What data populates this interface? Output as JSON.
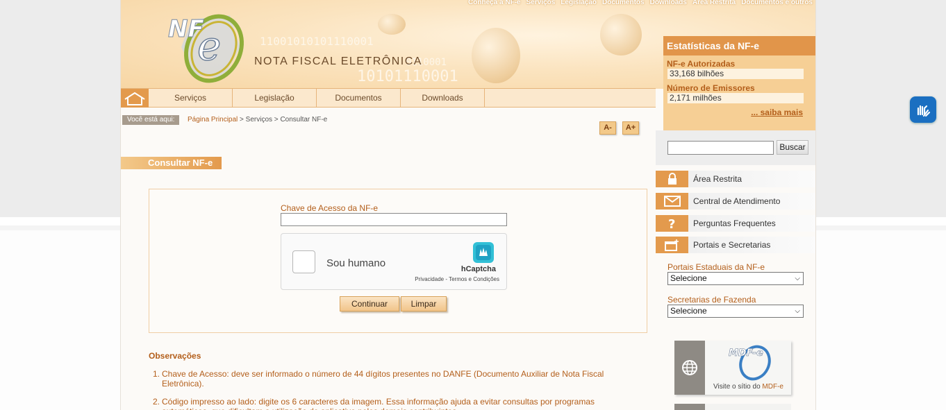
{
  "top_nav": [
    "Conheça a NF-e",
    "Serviços",
    "Legislação",
    "Documentos",
    "Downloads",
    "Área Restrita",
    "Documentos e outros"
  ],
  "header": {
    "logo_text": "NF-e",
    "title": "NOTA FISCAL ELETRÔNICA",
    "bits_a": "11001010101110001",
    "bits_b": "10101110001",
    "bits_c": "0110001"
  },
  "stats": {
    "title": "Estatísticas da NF-e",
    "authorized_label": "NF-e Autorizadas",
    "authorized_value": "33,168 bilhões",
    "issuers_label": "Número de Emissores",
    "issuers_value": "2,171 milhões",
    "more_link": "... saiba mais"
  },
  "main_nav": [
    "Serviços",
    "Legislação",
    "Documentos",
    "Downloads"
  ],
  "breadcrumb": {
    "tag": "Você está aqui:",
    "home": "Página Principal",
    "sep1": " > ",
    "section": "Serviços",
    "sep2": " > ",
    "current": "Consultar NF-e"
  },
  "font_controls": {
    "decrease": "A-",
    "increase": "A+"
  },
  "page_title": "Consultar NF-e",
  "form": {
    "key_label": "Chave de Acesso da NF-e",
    "key_value": "",
    "captcha_label": "Sou humano",
    "captcha_brand": "hCaptcha",
    "captcha_privacy": "Privacidade",
    "captcha_sep": " - ",
    "captcha_terms": "Termos e Condições",
    "submit": "Continuar",
    "clear": "Limpar"
  },
  "observations": {
    "title": "Observações",
    "items": [
      {
        "num": "1.",
        "text": "Chave de Acesso: deve ser informado o número de 44 dígitos presentes no DANFE (Documento Auxiliar de Nota Fiscal Eletrônica)."
      },
      {
        "num": "2.",
        "text": "Código impresso ao lado: digite os 6 caracteres da imagem. Essa informação ajuda a evitar consultas por programas automáticos, que dificultam a utilização do aplicativo pelos demais contribuintes."
      }
    ]
  },
  "sidebar": {
    "search_value": "",
    "search_button": "Buscar",
    "links": [
      "Área Restrita",
      "Central de Atendimento",
      "Perguntas Frequentes",
      "Portais e Secretarias"
    ],
    "portals_label": "Portais Estaduais da NF-e",
    "portals_selected": "Selecione",
    "secretarias_label": "Secretarias de Fazenda",
    "secretarias_selected": "Selecione",
    "mdfe_logo": "MDF-e",
    "mdfe_visit": "Visite o sítio do ",
    "mdfe_name": "MDF-e"
  },
  "colors": {
    "accent": "#e39a4d",
    "link": "#b35e1a",
    "header_bg": "#f7d6a4"
  }
}
